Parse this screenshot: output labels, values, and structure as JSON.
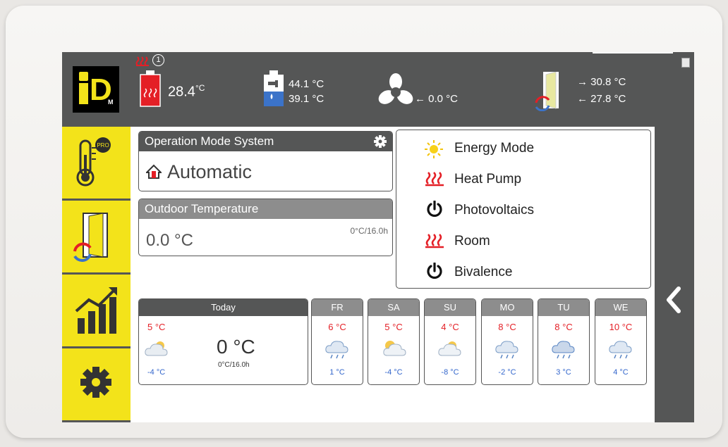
{
  "header": {
    "circuit_number": "1",
    "heating_buffer_temp": "28.4",
    "heating_buffer_unit": "°C",
    "hot_water_top": "44.1 °C",
    "hot_water_bottom": "39.1 °C",
    "fan_temp": "← 0.0 °C",
    "flow_temp": "→ 30.8 °C",
    "return_temp": "← 27.8 °C"
  },
  "operation_mode": {
    "title": "Operation Mode System",
    "value": "Automatic"
  },
  "outdoor": {
    "title": "Outdoor Temperature",
    "value": "0.0 °C",
    "meta": "0°C/16.0h"
  },
  "status_list": [
    {
      "label": "Energy Mode",
      "icon": "sun-icon"
    },
    {
      "label": "Heat Pump",
      "icon": "heating-icon"
    },
    {
      "label": "Photovoltaics",
      "icon": "power-icon"
    },
    {
      "label": "Room",
      "icon": "heating-icon"
    },
    {
      "label": "Bivalence",
      "icon": "power-icon"
    }
  ],
  "today": {
    "label": "Today",
    "high": "5 °C",
    "low": "-4 °C",
    "current": "0 °C",
    "meta": "0°C/16.0h"
  },
  "forecast": [
    {
      "day": "FR",
      "high": "6 °C",
      "low": "1 °C",
      "icon": "rain-cloud-icon"
    },
    {
      "day": "SA",
      "high": "5 °C",
      "low": "-4 °C",
      "icon": "sun-cloud-icon"
    },
    {
      "day": "SU",
      "high": "4 °C",
      "low": "-8 °C",
      "icon": "sun-cloud-icon"
    },
    {
      "day": "MO",
      "high": "8 °C",
      "low": "-2 °C",
      "icon": "rain-cloud-icon"
    },
    {
      "day": "TU",
      "high": "8 °C",
      "low": "3 °C",
      "icon": "rain-cloud-icon"
    },
    {
      "day": "WE",
      "high": "10 °C",
      "low": "4 °C",
      "icon": "rain-cloud-icon"
    }
  ],
  "colors": {
    "accent_yellow": "#f3e31a",
    "bar_gray": "#555656",
    "header_light_gray": "#8d8d8d",
    "temp_high_red": "#e41f26",
    "temp_low_blue": "#3366cc"
  }
}
